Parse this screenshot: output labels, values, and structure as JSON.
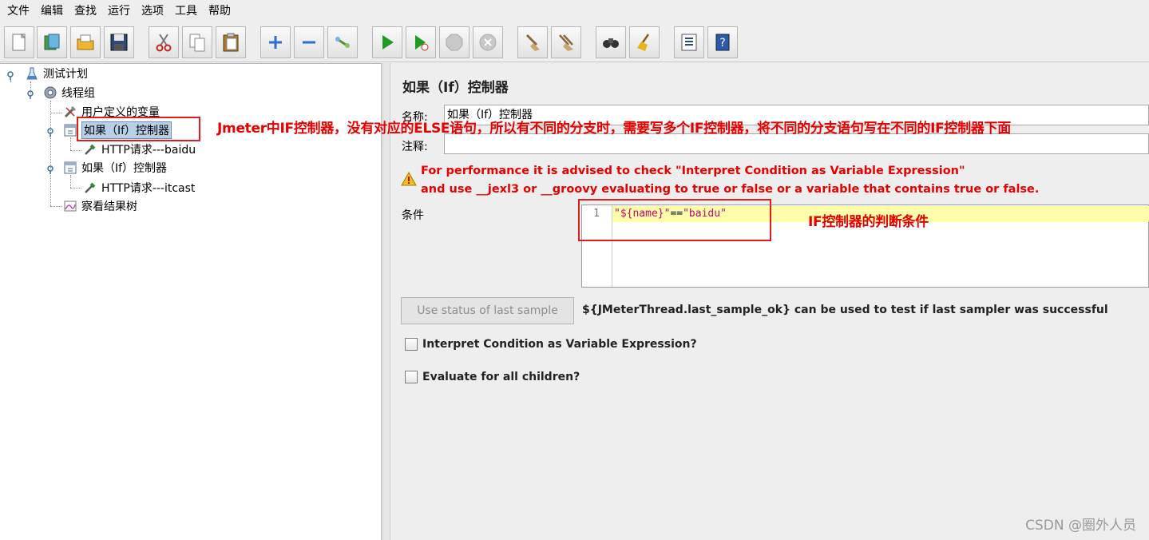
{
  "menu": [
    "文件",
    "编辑",
    "查找",
    "运行",
    "选项",
    "工具",
    "帮助"
  ],
  "toolbar": {
    "buttons": [
      {
        "name": "new-icon",
        "color": "#ffffff"
      },
      {
        "name": "templates-icon",
        "color": "#3c8b3c"
      },
      {
        "name": "open-icon",
        "color": "#e2a21c"
      },
      {
        "name": "save-icon",
        "color": "#1f3b63"
      },
      {
        "name": "cut-icon",
        "color": "#c0261f"
      },
      {
        "name": "copy-icon",
        "color": "#7a7a7a"
      },
      {
        "name": "paste-icon",
        "color": "#8a5a20"
      },
      {
        "name": "expand-icon",
        "color": "#2a6fd1"
      },
      {
        "name": "collapse-icon",
        "color": "#2a6fd1"
      },
      {
        "name": "toggle-icon",
        "color": "#5a8f3a"
      },
      {
        "name": "start-icon",
        "color": "#1f9a22"
      },
      {
        "name": "start-no-pause-icon",
        "color": "#1f9a22"
      },
      {
        "name": "stop-icon",
        "color": "#b5b5b5"
      },
      {
        "name": "shutdown-icon",
        "color": "#b5b5b5"
      },
      {
        "name": "clear-icon",
        "color": "#8a6a3a"
      },
      {
        "name": "clear-all-icon",
        "color": "#8a6a3a"
      },
      {
        "name": "search-icon",
        "color": "#222222"
      },
      {
        "name": "reset-search-icon",
        "color": "#e7b417"
      },
      {
        "name": "function-helper-icon",
        "color": "#2a4a7a"
      },
      {
        "name": "help-icon",
        "color": "#2a5aa8"
      }
    ]
  },
  "tree": {
    "test_plan": "测试计划",
    "thread_group": "线程组",
    "user_vars": "用户定义的变量",
    "if_controller_1": "如果（If）控制器",
    "http_baidu": "HTTP请求---baidu",
    "if_controller_2": "如果（If）控制器",
    "http_itcast": "HTTP请求---itcast",
    "result_tree": "察看结果树"
  },
  "panel": {
    "title": "如果（If）控制器",
    "name_label": "名称:",
    "name_value": "如果（If）控制器",
    "comment_label": "注释:",
    "comment_value": "",
    "warning_line1": "For performance it is advised to check \"Interpret Condition as Variable Expression\"",
    "warning_line2": "and use __jexl3 or __groovy evaluating to true or false or a variable that contains true or false.",
    "condition_label": "条件",
    "line_number": "1",
    "condition_str1": "\"${name}\"",
    "condition_op": "==",
    "condition_str2": "\"baidu\"",
    "status_button": "Use status of last sample",
    "status_note": "${JMeterThread.last_sample_ok} can be used to test if last sampler was successful",
    "checkbox_interpret": "Interpret Condition as Variable Expression?",
    "checkbox_evaluate": "Evaluate for all children?"
  },
  "annotations": {
    "note1": "Jmeter中IF控制器，没有对应的ELSE语句，所以有不同的分支时，需要写多个IF控制器，将不同的分支语句写在不同的IF控制器下面",
    "note2": "IF控制器的判断条件"
  },
  "watermark": "CSDN @圈外人员"
}
